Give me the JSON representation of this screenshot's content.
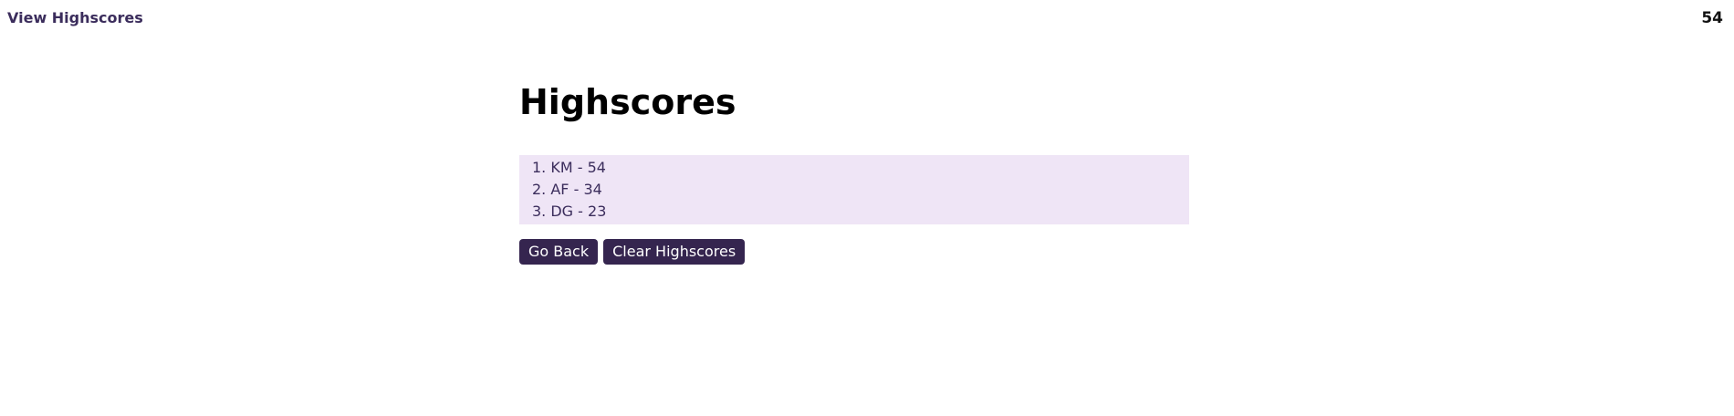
{
  "header": {
    "view_highscores_label": "View Highscores",
    "timer_value": "54"
  },
  "main": {
    "title": "Highscores",
    "scores": [
      {
        "rank": "1.",
        "text": "KM - 54"
      },
      {
        "rank": "2.",
        "text": "AF - 34"
      },
      {
        "rank": "3.",
        "text": "DG - 23"
      }
    ],
    "go_back_label": "Go Back",
    "clear_label": "Clear Highscores"
  },
  "colors": {
    "accent": "#35254f",
    "list_background": "#efe5f6",
    "link_text": "#3b2d5c"
  }
}
